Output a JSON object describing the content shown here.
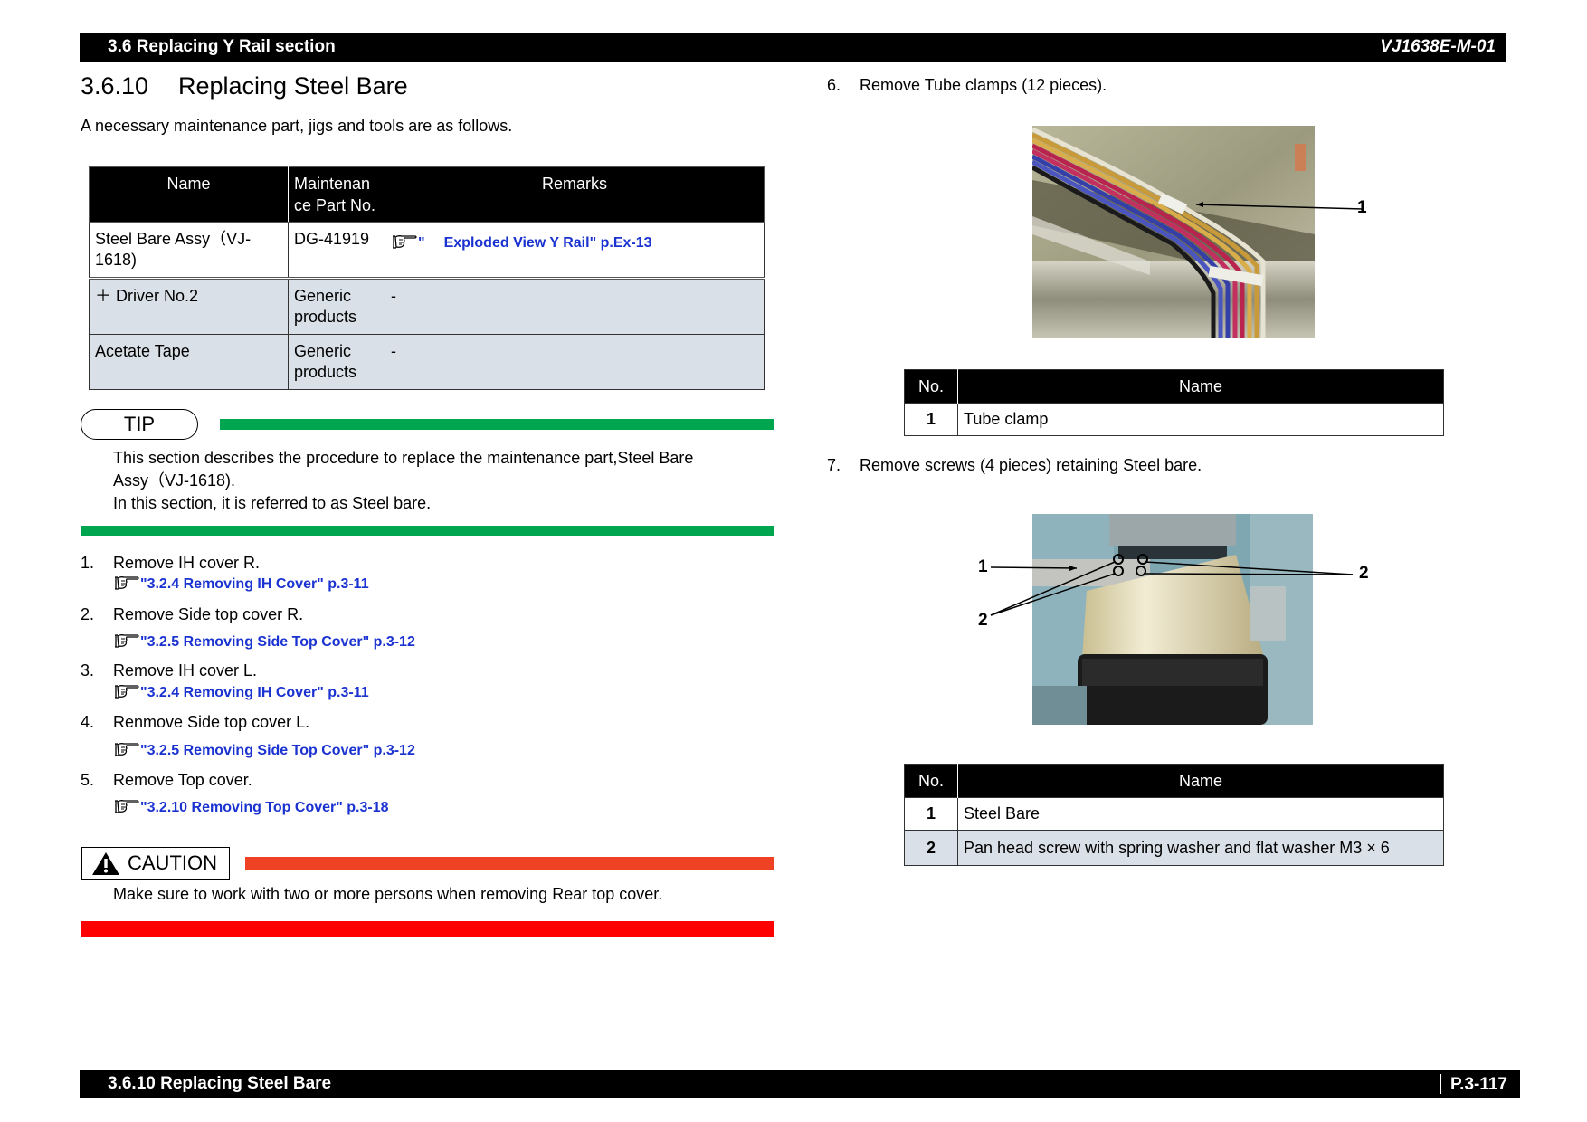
{
  "header": {
    "section": "3.6 Replacing Y Rail section",
    "doc_code": "VJ1638E-M-01"
  },
  "footer": {
    "section": "3.6.10 Replacing Steel Bare",
    "page": "P.3-117"
  },
  "title": {
    "number": "3.6.10",
    "text": "Replacing Steel Bare"
  },
  "intro": "A necessary maintenance part, jigs and tools are as follows.",
  "parts_table": {
    "headers": [
      "Name",
      "Maintenance Part No.",
      "Remarks"
    ],
    "header_part_no_line1": "Maintenan",
    "header_part_no_line2": "ce Part No.",
    "rows": [
      {
        "name": "Steel Bare Assy（VJ-1618)",
        "part_no": "DG-41919",
        "remarks_prefix": "\"",
        "remarks_link": "Exploded View Y Rail\" p.Ex-13"
      },
      {
        "name": "＋ Driver No.2",
        "part_no": "Generic products",
        "remarks": "-"
      },
      {
        "name": "Acetate Tape",
        "part_no": "Generic products",
        "remarks": "-"
      }
    ]
  },
  "tip": {
    "label": "TIP",
    "lines": [
      "This section describes the procedure to replace the maintenance part,Steel Bare",
      "Assy（VJ-1618).",
      "In this section, it is referred to as Steel bare."
    ]
  },
  "steps": [
    {
      "num": "1.",
      "text": "Remove IH cover R.",
      "ref": "\"3.2.4 Removing IH Cover\" p.3-11"
    },
    {
      "num": "2.",
      "text": "Remove Side top cover R.",
      "ref": "\"3.2.5 Removing Side Top Cover\" p.3-12"
    },
    {
      "num": "3.",
      "text": "Remove IH cover L.",
      "ref": "\"3.2.4 Removing IH Cover\" p.3-11"
    },
    {
      "num": "4.",
      "text": "Renmove Side top cover L.",
      "ref": "\"3.2.5 Removing Side Top Cover\" p.3-12"
    },
    {
      "num": "5.",
      "text": "Remove Top cover.",
      "ref": "\"3.2.10 Removing Top Cover\" p.3-18"
    },
    {
      "num": "6.",
      "text": "Remove Tube clamps (12 pieces)."
    },
    {
      "num": "7.",
      "text": "Remove screws (4 pieces) retaining Steel bare."
    }
  ],
  "caution": {
    "label": "CAUTION",
    "text": "Make sure to work with two or more persons when removing Rear top cover."
  },
  "figure1": {
    "description": "Photo of ink tubes held by a tube clamp",
    "callouts": [
      "1"
    ]
  },
  "table_tube": {
    "headers": [
      "No.",
      "Name"
    ],
    "rows": [
      {
        "no": "1",
        "name": "Tube clamp"
      }
    ]
  },
  "figure2": {
    "description": "Photo of steel bare with four retaining screws circled",
    "callouts": [
      "1",
      "2",
      "2"
    ]
  },
  "table_screws": {
    "headers": [
      "No.",
      "Name"
    ],
    "rows": [
      {
        "no": "1",
        "name": "Steel Bare"
      },
      {
        "no": "2",
        "name": "Pan head screw with spring washer and flat washer M3 × 6"
      }
    ]
  },
  "colors": {
    "link": "#1a32d0",
    "tip_bar": "#00a550",
    "caution_bar_top": "#ef4123",
    "caution_bar_bottom": "#ff0000",
    "table_alt_row": "#d9e0e7"
  }
}
